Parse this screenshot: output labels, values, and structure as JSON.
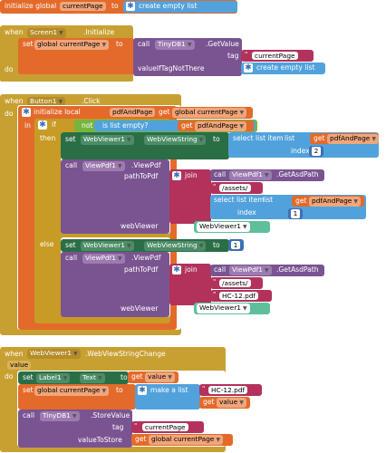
{
  "init_global": {
    "keyword": "initialize global",
    "name": "currentPage",
    "to": "to",
    "value": "create empty list"
  },
  "screen_init": {
    "when": "when",
    "component": "Screen1",
    "event": ".Initialize",
    "do": "do",
    "set": "set",
    "var": "global currentPage",
    "to": "to",
    "call": "call",
    "db": "TinyDB1",
    "method": ".GetValue",
    "tag_label": "tag",
    "tag_value": "currentPage",
    "default_label": "valueIfTagNotThere",
    "default_value": "create empty list"
  },
  "button_click": {
    "when": "when",
    "component": "Button1",
    "event": ".Click",
    "do": "do",
    "init_local": "initialize local",
    "local_name": "pdfAndPage",
    "to": "to",
    "get": "get",
    "get_global": "global currentPage",
    "in": "in",
    "if": "if",
    "not": "not",
    "is_list_empty": "is list empty?",
    "list_label": "list",
    "get_local": "pdfAndPage",
    "then": "then",
    "set": "set",
    "webviewer": "WebViewer1",
    "prop": "WebViewString",
    "select_item": "select list item",
    "index_label": "index",
    "index_value": "2",
    "call": "call",
    "viewpdf": "ViewPdf1",
    "viewpdf_method": ".ViewPdf",
    "path_label": "pathToPdf",
    "join": "join",
    "asdpath": "ViewPdf1",
    "asdpath_method": ".GetAsdPath",
    "assets": "/assets/",
    "index_value2": "1",
    "webviewer_label": "webViewer",
    "webviewer_value": "WebViewer1",
    "else": "else",
    "else_set_value": "1",
    "file": "HC-12.pdf"
  },
  "wv_change": {
    "when": "when",
    "component": "WebViewer1",
    "event": ".WebViewStringChange",
    "param": "value",
    "do": "do",
    "set": "set",
    "label": "Label1",
    "label_prop": "Text",
    "to": "to",
    "get": "get",
    "get_value": "value",
    "var": "global currentPage",
    "make_list": "make a list",
    "file": "HC-12.pdf",
    "call": "call",
    "db": "TinyDB1",
    "method": ".StoreValue",
    "tag_label": "tag",
    "tag_value": "currentPage",
    "store_label": "valueToStore",
    "store_get": "global currentPage"
  }
}
